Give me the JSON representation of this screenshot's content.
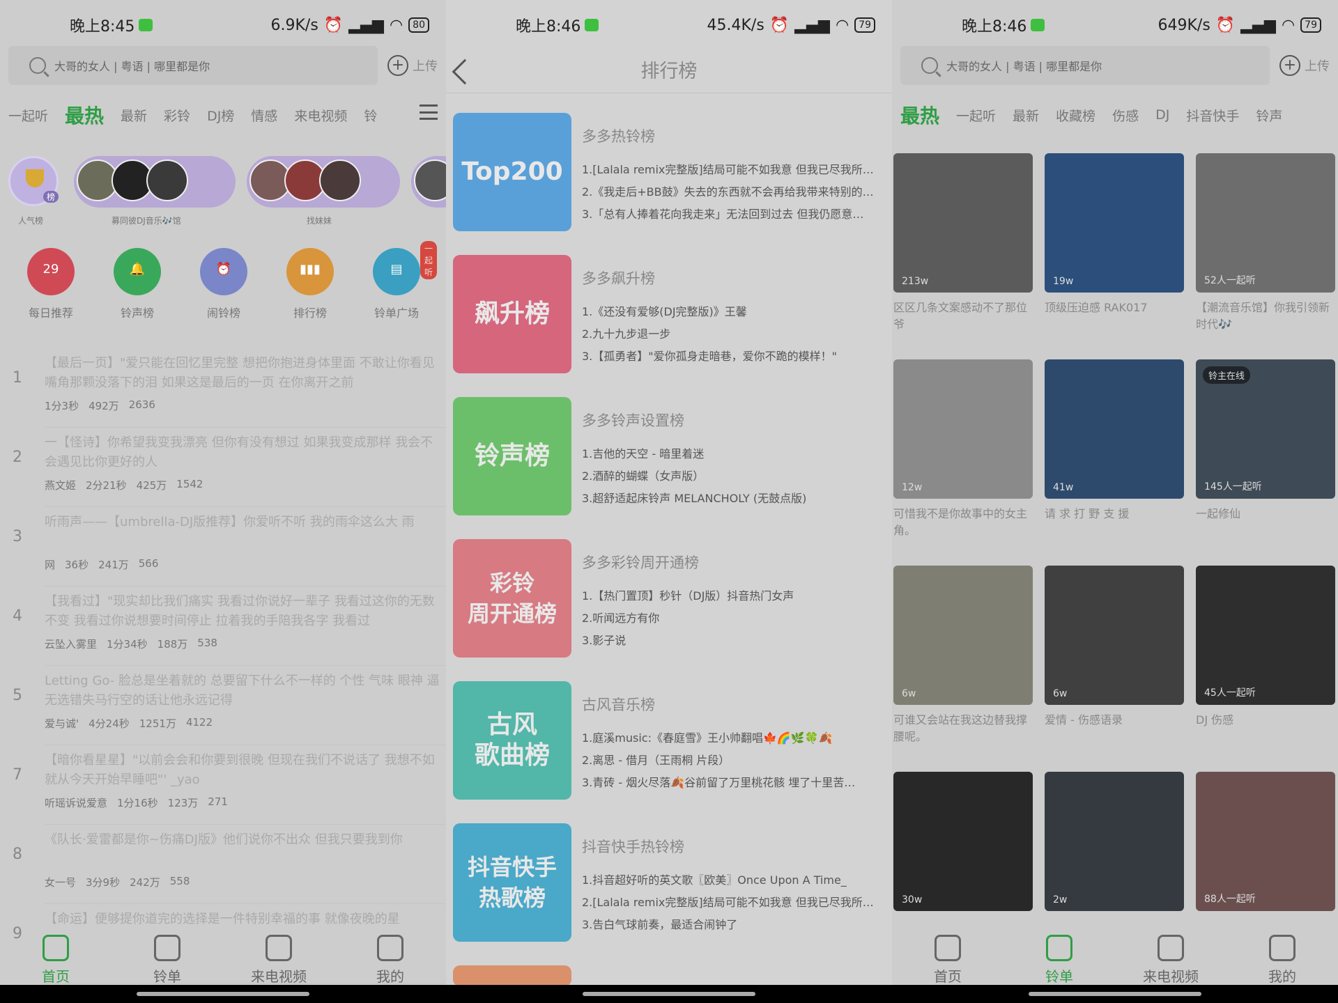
{
  "screens": [
    {
      "status": {
        "time": "晚上8:45",
        "speed": "6.9K/s",
        "battery": "80"
      },
      "search": {
        "placeholder": "大哥的女人 | 粤语 | 哪里都是你",
        "upload": "上传"
      },
      "tabs": [
        "一起听",
        "最热",
        "最新",
        "彩铃",
        "DJ榜",
        "情感",
        "来电视频",
        "铃"
      ],
      "active_tab": "最热",
      "pill_caps": [
        "人气榜",
        "募同彼DJ音乐🎶馆",
        "找妹妹"
      ],
      "trophy_badge": "榜",
      "quick": [
        {
          "label": "每日推荐",
          "color": "#cf4a55",
          "glyph": "29"
        },
        {
          "label": "铃声榜",
          "color": "#3aa85a",
          "glyph": "🔔"
        },
        {
          "label": "闹铃榜",
          "color": "#7a86c8",
          "glyph": "⏰"
        },
        {
          "label": "排行榜",
          "color": "#d9953b",
          "glyph": "▮▮▮"
        },
        {
          "label": "铃单广场",
          "color": "#3a9fc0",
          "glyph": "▤",
          "bubble": "一起听"
        }
      ],
      "songs": [
        {
          "n": "1",
          "text": "【最后一页】\"爱只能在回忆里完整 想把你抱进身体里面 不敢让你看见 嘴角那颗没落下的泪 如果这是最后的一页 在你离开之前",
          "author": "",
          "dur": "1分3秒",
          "likes": "492万",
          "comments": "2636"
        },
        {
          "n": "2",
          "text": "一【怪诗】你希望我变我漂亮 但你有没有想过 如果我变成那样 我会不会遇见比你更好的人",
          "author": "燕文姬",
          "dur": "2分21秒",
          "likes": "425万",
          "comments": "1542"
        },
        {
          "n": "3",
          "text": "听雨声——【umbrella-DJ版推荐】你爱听不听 我的雨伞这么大 雨",
          "author": "网",
          "dur": "36秒",
          "likes": "241万",
          "comments": "566"
        },
        {
          "n": "4",
          "text": "【我看过】\"现实却比我们痛实 我看过你说好一辈子 我看过这你的无数不变 我看过你说想要时间停止 拉着我的手陪我各字 我看过",
          "author": "云坠入雾里",
          "dur": "1分34秒",
          "likes": "188万",
          "comments": "538"
        },
        {
          "n": "5",
          "text": "Letting Go- 脸总是坐着就的 总要留下什么不一样的 个性 气味 眼神 逼无选错失马行空的话让他永远记得",
          "author": "爱与诚'",
          "dur": "4分24秒",
          "likes": "1251万",
          "comments": "4122"
        },
        {
          "n": "7",
          "text": "【暗你看星星】\"以前会会和你要到很晚 但现在我们不说话了 我想不如就从今天开始早睡吧\"' _yao",
          "author": "听瑶诉说爱意",
          "dur": "1分16秒",
          "likes": "123万",
          "comments": "271"
        },
        {
          "n": "8",
          "text": "《队长·爱雷都是你~伤痛DJ版》他们说你不出众 但我只要我到你",
          "author": "女一号",
          "dur": "3分9秒",
          "likes": "242万",
          "comments": "558"
        },
        {
          "n": "9",
          "text": "【命运】便够提你道完的选择是一件特别幸福的事 就像夜晚的星",
          "author": "",
          "dur": "",
          "likes": "",
          "comments": ""
        }
      ],
      "nav": [
        "首页",
        "铃单",
        "来电视频",
        "我的"
      ],
      "nav_active": 0
    },
    {
      "status": {
        "time": "晚上8:46",
        "speed": "45.4K/s",
        "battery": "79"
      },
      "title": "排行榜",
      "ranks": [
        {
          "cover": "Top200",
          "color": "#5aa0d8",
          "title": "多多热铃榜",
          "items": [
            "1.[Lalala remix完整版]结局可能不如我意 但我已尽我所…",
            "2.《我走后+BB鼓》失去的东西就不会再给我带来特别的…",
            "3.「总有人捧着花向我走来」无法回到过去 但我仍愿意…"
          ]
        },
        {
          "cover": "飙升榜",
          "color": "#d5667c",
          "title": "多多飙升榜",
          "items": [
            "1.《还没有爱够(DJ完整版)》王馨",
            "2.九十九步退一步",
            "3.【孤勇者】\"爱你孤身走暗巷，爱你不跪的模样！\""
          ]
        },
        {
          "cover": "铃声榜",
          "color": "#6cbf6a",
          "title": "多多铃声设置榜",
          "items": [
            "1.吉他的天空 - 暗里着迷",
            "2.酒醉的蝴蝶（女声版）",
            "3.超舒适起床铃声 MELANCHOLY (无鼓点版)"
          ]
        },
        {
          "cover": "彩铃\n周开通榜",
          "color": "#d77a82",
          "title": "多多彩铃周开通榜",
          "items": [
            "1.【热门置顶】秒针（DJ版）抖音热门女声",
            "2.听闻远方有你",
            "3.影子说"
          ]
        },
        {
          "cover": "古风\n歌曲榜",
          "color": "#52b6a8",
          "title": "古风音乐榜",
          "items": [
            "1.庭溪music:《春庭雪》王小帅翻唱🍁🌈🌿🍀🍂",
            "2.离思 - 借月（王雨桐 片段）",
            "3.青砖 - 烟火尽落🍂谷前留了万里桃花骸  埋了十里苦…"
          ]
        },
        {
          "cover": "抖音快手\n热歌榜",
          "color": "#4aa8c8",
          "title": "抖音快手热铃榜",
          "items": [
            "1.抖音超好听的英文歌〖欧美〗Once Upon A Time_",
            "2.[Lalala remix完整版]结局可能不如我意 但我已尽我所…",
            "3.告白气球前奏，最适合闹钟了"
          ]
        }
      ]
    },
    {
      "status": {
        "time": "晚上8:46",
        "speed": "649K/s",
        "battery": "79"
      },
      "search": {
        "placeholder": "大哥的女人 | 粤语 | 哪里都是你",
        "upload": "上传"
      },
      "tabs": [
        "最热",
        "一起听",
        "最新",
        "收藏榜",
        "伤感",
        "DJ",
        "抖音快手",
        "铃声"
      ],
      "active_tab": "最热",
      "cards": [
        {
          "badge": "213w",
          "cap": "区区几条文案感动不了那位爷",
          "img": "#5b5b5b"
        },
        {
          "badge": "19w",
          "cap": "顶级压迫感  RAK017",
          "img": "#2b4f7a"
        },
        {
          "badge": "52人一起听",
          "cap": "【潮流音乐馆】你我引领新时代🎶",
          "img": "#6d6d6d"
        },
        {
          "badge": "12w",
          "cap": "可惜我不是你故事中的女主角。",
          "img": "#8a8a8a"
        },
        {
          "badge": "41w",
          "cap": "请 求 打 野 支 援",
          "img": "#2d4a6d"
        },
        {
          "badge": "145人一起听",
          "cap": "一起修仙",
          "img": "#3e4a55",
          "tag": "铃主在线"
        },
        {
          "badge": "6w",
          "cap": "可谁又会站在我这边替我撑腰呢。",
          "img": "#7e7e72"
        },
        {
          "badge": "6w",
          "cap": "爱情 - 伤感语录",
          "img": "#404040"
        },
        {
          "badge": "45人一起听",
          "cap": "DJ  伤感",
          "img": "#2e2e2e"
        },
        {
          "badge": "30w",
          "cap": "",
          "img": "#282828"
        },
        {
          "badge": "2w",
          "cap": "",
          "img": "#353a40"
        },
        {
          "badge": "88人一起听",
          "cap": "",
          "img": "#6b4f4f"
        }
      ],
      "nav": [
        "首页",
        "铃单",
        "来电视频",
        "我的"
      ],
      "nav_active": 1
    }
  ],
  "colors": {
    "accent": "#2f9e45"
  }
}
